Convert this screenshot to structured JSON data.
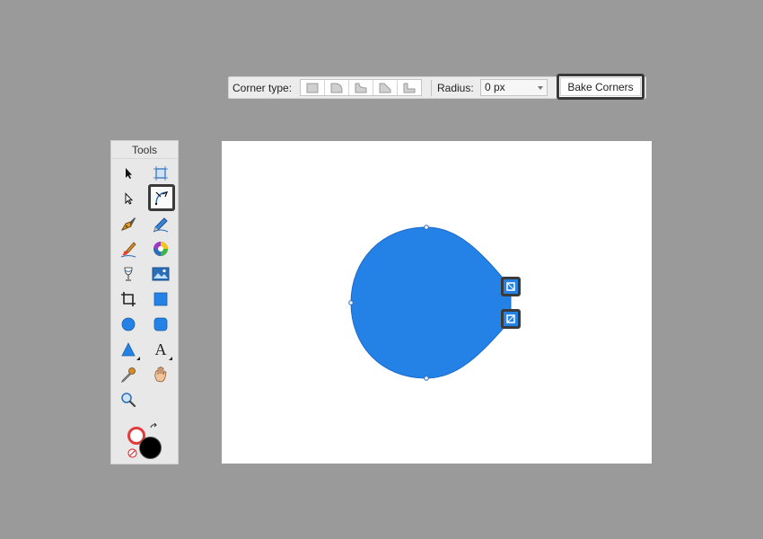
{
  "context_toolbar": {
    "corner_type_label": "Corner type:",
    "corner_types": [
      "none-corner",
      "rounded-corner",
      "concave-corner",
      "chamfer-corner",
      "straight-corner"
    ],
    "radius_label": "Radius:",
    "radius_value": "0 px",
    "bake_label": "Bake Corners"
  },
  "tools_panel": {
    "title": "Tools",
    "tools": [
      {
        "name": "move-tool-icon",
        "active": false
      },
      {
        "name": "artboard-tool-icon",
        "active": false
      },
      {
        "name": "node-tool-icon",
        "active": false
      },
      {
        "name": "corner-tool-icon",
        "active": true
      },
      {
        "name": "pen-tool-icon",
        "active": false
      },
      {
        "name": "pencil-tool-icon",
        "active": false
      },
      {
        "name": "vector-brush-tool-icon",
        "active": false
      },
      {
        "name": "color-picker-wheel-icon",
        "active": false
      },
      {
        "name": "fill-tool-icon",
        "active": false
      },
      {
        "name": "place-image-tool-icon",
        "active": false
      },
      {
        "name": "crop-tool-icon",
        "active": false
      },
      {
        "name": "rectangle-tool-icon",
        "active": false
      },
      {
        "name": "ellipse-tool-icon",
        "active": false
      },
      {
        "name": "rounded-rectangle-tool-icon",
        "active": false
      },
      {
        "name": "triangle-tool-icon",
        "active": false
      },
      {
        "name": "text-tool-icon",
        "active": false
      },
      {
        "name": "color-picker-tool-icon",
        "active": false
      },
      {
        "name": "view-tool-icon",
        "active": false
      },
      {
        "name": "zoom-tool-icon",
        "active": false
      }
    ],
    "text_tool_glyph": "A",
    "stroke_color": "#ffffff",
    "fill_color": "#000000"
  },
  "canvas": {
    "shape_color": "#2481e6",
    "background": "#ffffff"
  }
}
